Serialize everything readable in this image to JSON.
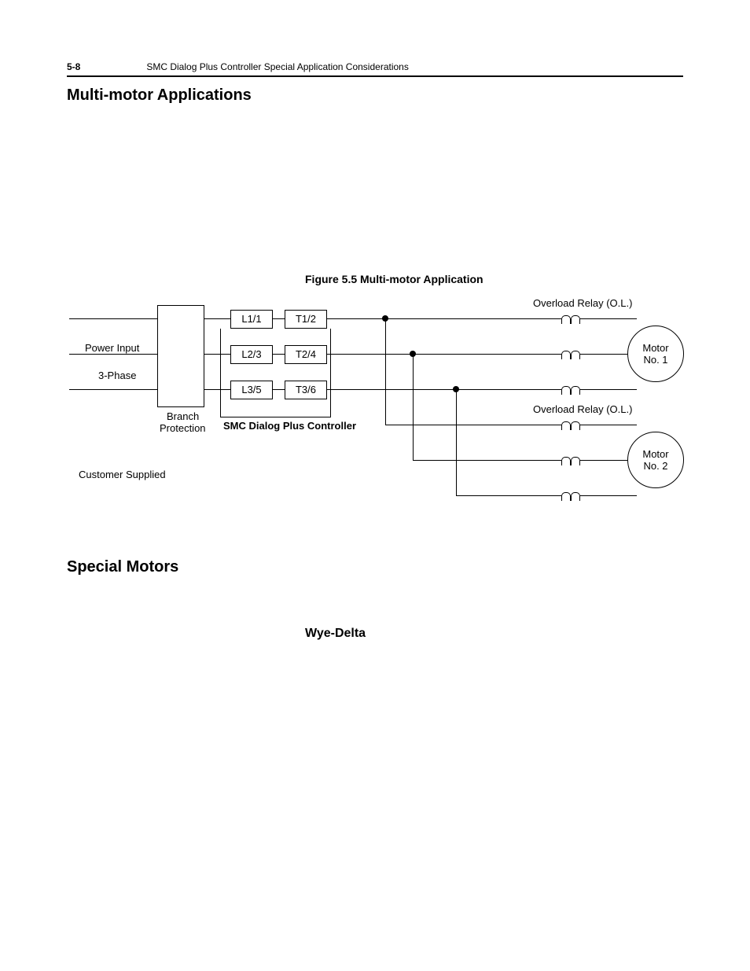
{
  "header": {
    "pagenum": "5-8",
    "title": "SMC Dialog Plus Controller Special Application Considerations"
  },
  "headings": {
    "multi_motor": "Multi-motor Applications",
    "special_motors": "Special Motors",
    "wye_delta": "Wye-Delta"
  },
  "figure": {
    "caption": "Figure 5.5   Multi-motor Application",
    "labels": {
      "power_input": "Power Input",
      "three_phase": "3-Phase",
      "branch_protection_1": "Branch",
      "branch_protection_2": "Protection",
      "customer_supplied": "Customer Supplied",
      "controller": "SMC Dialog Plus Controller",
      "overload_top": "Overload Relay (O.L.)",
      "overload_bottom": "Overload Relay (O.L.)",
      "motor1_a": "Motor",
      "motor1_b": "No. 1",
      "motor2_a": "Motor",
      "motor2_b": "No. 2",
      "L1": "L1/1",
      "L2": "L2/3",
      "L3": "L3/5",
      "T1": "T1/2",
      "T2": "T2/4",
      "T3": "T3/6"
    }
  }
}
